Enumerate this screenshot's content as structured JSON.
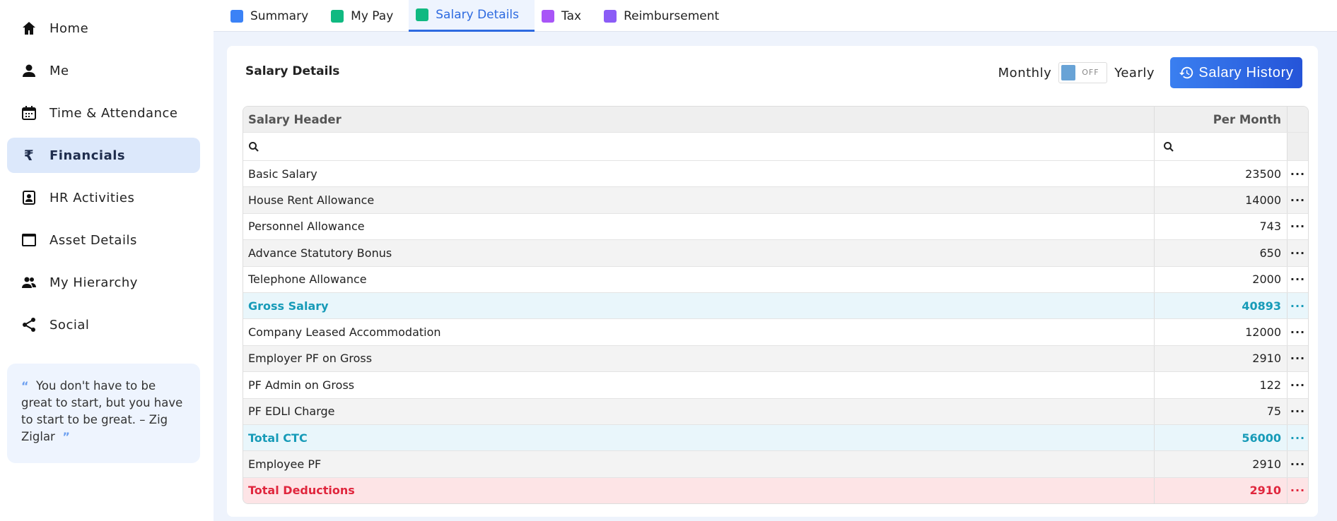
{
  "sidebar": {
    "items": [
      {
        "label": "Home",
        "icon": "home-icon"
      },
      {
        "label": "Me",
        "icon": "person-icon"
      },
      {
        "label": "Time & Attendance",
        "icon": "calendar-icon"
      },
      {
        "label": "Financials",
        "icon": "rupee-icon",
        "active": true
      },
      {
        "label": "HR Activities",
        "icon": "badge-icon"
      },
      {
        "label": "Asset Details",
        "icon": "window-icon"
      },
      {
        "label": "My Hierarchy",
        "icon": "people-icon"
      },
      {
        "label": "Social",
        "icon": "share-icon"
      }
    ],
    "quote": "You don't have to be great to start, but you have to start to be great. – Zig Ziglar"
  },
  "tabs": [
    {
      "label": "Summary",
      "color": "#3b82f6"
    },
    {
      "label": "My Pay",
      "color": "#10b981"
    },
    {
      "label": "Salary Details",
      "color": "#10b981"
    },
    {
      "label": "Tax",
      "color": "#a855f7"
    },
    {
      "label": "Reimbursement",
      "color": "#8b5cf6"
    }
  ],
  "card": {
    "title": "Salary Details",
    "monthly": "Monthly",
    "toggle": "OFF",
    "yearly": "Yearly",
    "history_button": "Salary History"
  },
  "table": {
    "headers": [
      "Salary Header",
      "Per Month"
    ],
    "action": "···",
    "rows": [
      {
        "name": "Basic Salary",
        "value": "23500",
        "type": "normal"
      },
      {
        "name": "House Rent Allowance",
        "value": "14000",
        "type": "normal"
      },
      {
        "name": "Personnel Allowance",
        "value": "743",
        "type": "normal"
      },
      {
        "name": "Advance Statutory Bonus",
        "value": "650",
        "type": "normal"
      },
      {
        "name": "Telephone Allowance",
        "value": "2000",
        "type": "normal"
      },
      {
        "name": "Gross Salary",
        "value": "40893",
        "type": "total"
      },
      {
        "name": "Company Leased Accommodation",
        "value": "12000",
        "type": "normal"
      },
      {
        "name": "Employer PF on Gross",
        "value": "2910",
        "type": "normal"
      },
      {
        "name": "PF Admin on Gross",
        "value": "122",
        "type": "normal"
      },
      {
        "name": "PF EDLI Charge",
        "value": "75",
        "type": "normal"
      },
      {
        "name": "Total CTC",
        "value": "56000",
        "type": "total"
      },
      {
        "name": "Employee PF",
        "value": "2910",
        "type": "normal"
      },
      {
        "name": "Total Deductions",
        "value": "2910",
        "type": "ded"
      }
    ]
  }
}
